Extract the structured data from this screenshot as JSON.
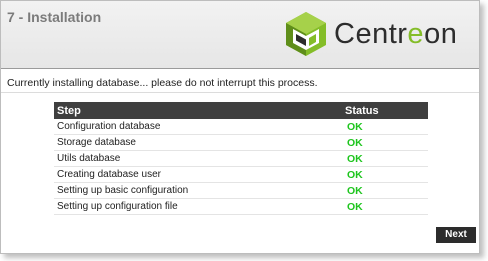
{
  "header": {
    "title": "7 - Installation",
    "logo": {
      "text_main": "Centr",
      "text_accent": "e",
      "text_tail": "on",
      "icon": "centreon-cube-icon"
    }
  },
  "message": "Currently installing database... please do not interrupt this process.",
  "table": {
    "columns": [
      "Step",
      "Status"
    ],
    "rows": [
      {
        "step": "Configuration database",
        "status": "OK"
      },
      {
        "step": "Storage database",
        "status": "OK"
      },
      {
        "step": "Utils database",
        "status": "OK"
      },
      {
        "step": "Creating database user",
        "status": "OK"
      },
      {
        "step": "Setting up basic configuration",
        "status": "OK"
      },
      {
        "step": "Setting up configuration file",
        "status": "OK"
      }
    ]
  },
  "buttons": {
    "next": "Next"
  },
  "colors": {
    "ok": "#1ec51e",
    "brand_green": "#84bd28",
    "header_bar": "#3f3f3f"
  }
}
